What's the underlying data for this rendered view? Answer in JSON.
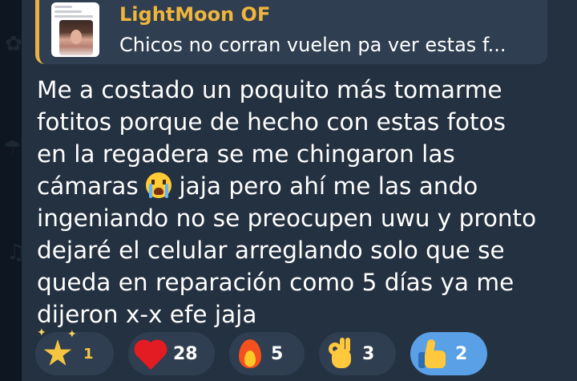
{
  "reply": {
    "name": "LightMoon OF",
    "text": "Chicos no corran vuelen pa ver estas f..."
  },
  "message": {
    "line1": "Me a costado un poquito más tomarme",
    "line2": "fotitos porque de hecho con estas fotos",
    "line3": "en la regadera se me chingaron las",
    "line4_before": "cámaras ",
    "line4_emoji": "loudly-crying-face-emoji",
    "line4_after": " jaja pero ahí me las ando",
    "line5": "ingeniando no se preocupen uwu y pronto",
    "line6": "dejaré el celular arreglando solo que se",
    "line7": "queda en reparación como 5 días ya me",
    "line8": "dijeron x-x efe jaja"
  },
  "reactions": [
    {
      "icon": "star-icon",
      "count": "1",
      "active": false
    },
    {
      "icon": "heart-icon",
      "count": "28",
      "active": false
    },
    {
      "icon": "fire-icon",
      "count": "5",
      "active": false
    },
    {
      "icon": "ok-hand-icon",
      "count": "3",
      "active": false
    },
    {
      "icon": "thumbs-up-icon",
      "count": "2",
      "active": true
    }
  ],
  "colors": {
    "background": "#0e1621",
    "bubble": "#243140",
    "reply_accent": "#e9b145",
    "reply_name": "#efb53d",
    "active_reaction": "#5aa0e6"
  }
}
